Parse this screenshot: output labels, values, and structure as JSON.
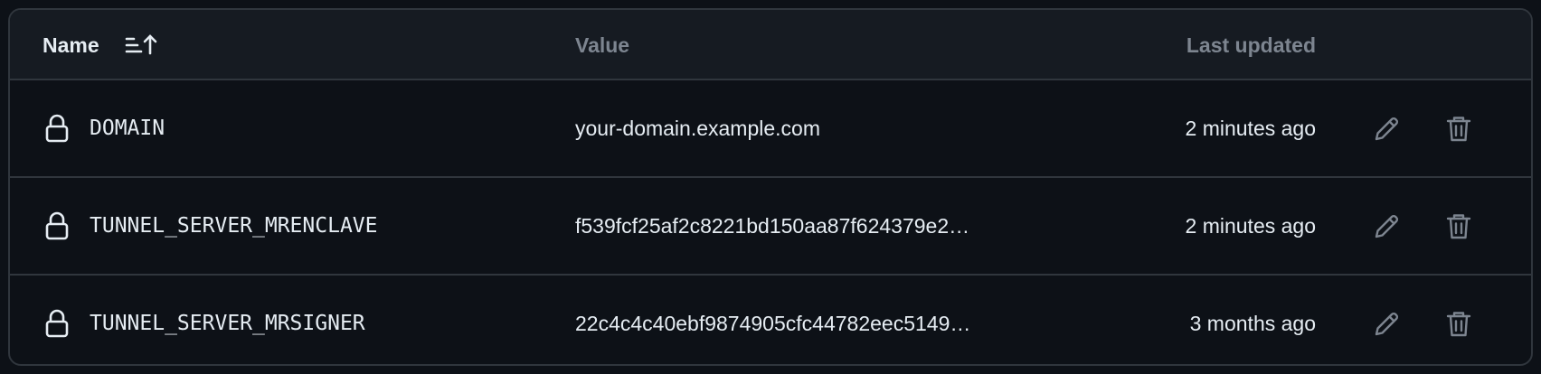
{
  "table": {
    "columns": {
      "name": "Name",
      "value": "Value",
      "last_updated": "Last updated"
    },
    "rows": [
      {
        "name": "DOMAIN",
        "value": "your-domain.example.com",
        "last_updated": "2 minutes ago"
      },
      {
        "name": "TUNNEL_SERVER_MRENCLAVE",
        "value": "f539fcf25af2c8221bd150aa87f624379e2…",
        "last_updated": "2 minutes ago"
      },
      {
        "name": "TUNNEL_SERVER_MRSIGNER",
        "value": "22c4c4c40ebf9874905cfc44782eec5149…",
        "last_updated": "3 months ago"
      }
    ]
  },
  "icons": {
    "sort": "sort-ascending-icon",
    "row": "lock-icon",
    "edit": "pencil-icon",
    "delete": "trash-icon"
  },
  "colors": {
    "background": "#0d1117",
    "header_background": "#161b22",
    "border": "#30363d",
    "text_primary": "#e6edf3",
    "text_muted": "#7d8590"
  }
}
